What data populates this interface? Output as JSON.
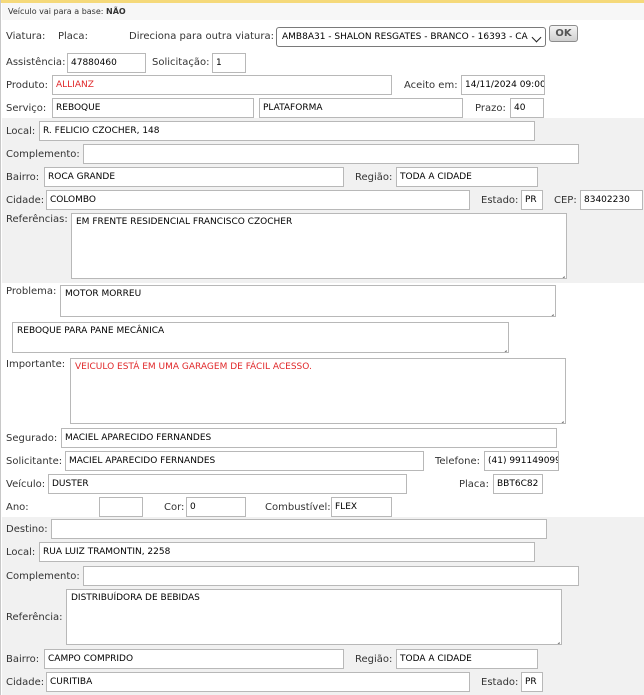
{
  "header": {
    "base_text": "Veículo vai para a base:",
    "base_value": "NÃO"
  },
  "top": {
    "viatura_label": "Viatura:",
    "placa_label": "Placa:",
    "direciona_label": "Direciona para outra viatura:",
    "direciona_value": "AMB8A31 - SHALON RESGATES - BRANCO - 16393 - CA",
    "ok_label": "OK",
    "assistencia_label": "Assistência:",
    "assistencia_value": "47880460",
    "solicitacao_label": "Solicitação:",
    "solicitacao_value": "1",
    "produto_label": "Produto:",
    "produto_value": "ALLIANZ",
    "aceito_label": "Aceito em:",
    "aceito_value": "14/11/2024 09:00",
    "servico_label": "Serviço:",
    "servico_value": "REBOQUE",
    "servico_tipo_value": "PLATAFORMA",
    "prazo_label": "Prazo:",
    "prazo_value": "40"
  },
  "origem": {
    "local_label": "Local:",
    "local_value": "R. FELICIO CZOCHER, 148",
    "complemento_label": "Complemento:",
    "complemento_value": "",
    "bairro_label": "Bairro:",
    "bairro_value": "ROCA GRANDE",
    "regiao_label": "Região:",
    "regiao_value": "TODA A CIDADE",
    "cidade_label": "Cidade:",
    "cidade_value": "COLOMBO",
    "estado_label": "Estado:",
    "estado_value": "PR",
    "cep_label": "CEP:",
    "cep_value": "83402230",
    "referencias_label": "Referências:",
    "referencias_value": "EM FRENTE RESIDENCIAL FRANCISCO CZOCHER"
  },
  "ocorrencia": {
    "problema_label": "Problema:",
    "problema_value": "MOTOR MORREU",
    "descricao_value": "REBOQUE PARA PANE MECÂNICA",
    "importante_label": "Importante:",
    "importante_value": "VEICULO ESTÁ EM UMA GARAGEM DE FÁCIL ACESSO.",
    "segurado_label": "Segurado:",
    "segurado_value": "MACIEL APARECIDO FERNANDES",
    "solicitante_label": "Solicitante:",
    "solicitante_value": "MACIEL APARECIDO FERNANDES",
    "telefone_label": "Telefone:",
    "telefone_value": "(41) 991149099",
    "veiculo_label": "Veículo:",
    "veiculo_value": "DUSTER",
    "placa_label": "Placa:",
    "placa_value": "BBT6C82",
    "ano_label": "Ano:",
    "ano_value": "",
    "cor_label": "Cor:",
    "cor_value": "0",
    "combustivel_label": "Combustível:",
    "combustivel_value": "FLEX"
  },
  "destino": {
    "destino_label": "Destino:",
    "destino_value": "",
    "local_label": "Local:",
    "local_value": "RUA LUIZ TRAMONTIN, 2258",
    "complemento_label": "Complemento:",
    "complemento_value": "",
    "referencia_label": "Referência:",
    "referencia_value": "DISTRIBUÍDORA DE BEBIDAS",
    "bairro_label": "Bairro:",
    "bairro_value": "CAMPO COMPRIDO",
    "regiao_label": "Região:",
    "regiao_value": "TODA A CIDADE",
    "cidade_label": "Cidade:",
    "cidade_value": "CURITIBA",
    "estado_label": "Estado:",
    "estado_value": "PR"
  },
  "colors": {
    "accent_red": "#e0282a",
    "band_gray": "#f1f1f1",
    "top_line": "#f5d97a"
  }
}
